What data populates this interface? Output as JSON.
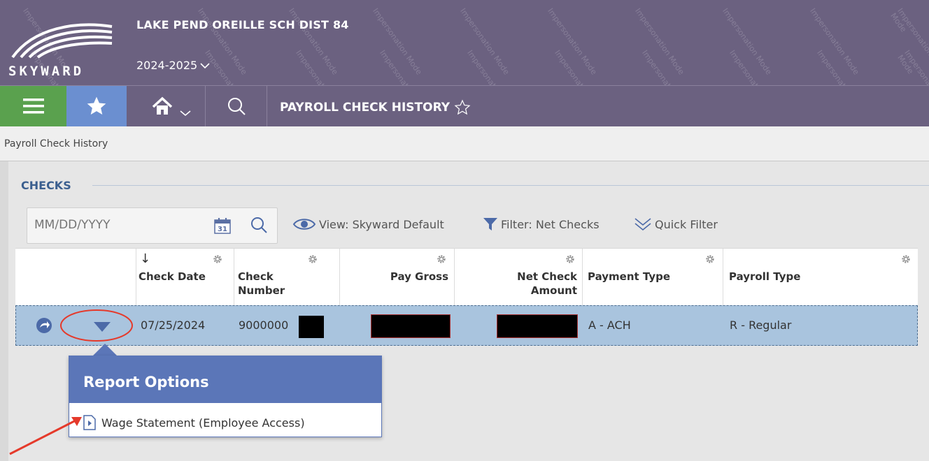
{
  "header": {
    "district": "LAKE PEND OREILLE SCH DIST 84",
    "year": "2024-2025",
    "watermark": "Impersonation Mode",
    "logo_text": "SKYWARD"
  },
  "nav": {
    "page_title": "PAYROLL CHECK HISTORY"
  },
  "breadcrumb": "Payroll Check History",
  "section": {
    "title": "CHECKS"
  },
  "toolbar": {
    "date_placeholder": "MM/DD/YYYY",
    "calendar_day": "31",
    "view_label": "View: Skyward Default",
    "filter_label": "Filter: Net Checks",
    "quick_filter_label": "Quick Filter"
  },
  "grid": {
    "sort_arrow": "↓",
    "columns": [
      {
        "line1": "Check Date",
        "line2": ""
      },
      {
        "line1": "Check",
        "line2": "Number"
      },
      {
        "line1": "Pay Gross",
        "line2": ""
      },
      {
        "line1": "Net Check",
        "line2": "Amount"
      },
      {
        "line1": "Payment Type",
        "line2": ""
      },
      {
        "line1": "Payroll Type",
        "line2": ""
      }
    ],
    "rows": [
      {
        "check_date": "07/25/2024",
        "check_number": "9000000",
        "payment_type": "A - ACH",
        "payroll_type": "R - Regular"
      }
    ]
  },
  "popup": {
    "title": "Report Options",
    "item": "Wage Statement (Employee Access)"
  },
  "colors": {
    "header_bg": "#6b6180",
    "menu_green": "#5aa14e",
    "favorites_blue": "#6b8fd0",
    "row_selected": "#a9c4de",
    "popup_blue": "#5b76b8",
    "annotation_red": "#e53a2b"
  }
}
